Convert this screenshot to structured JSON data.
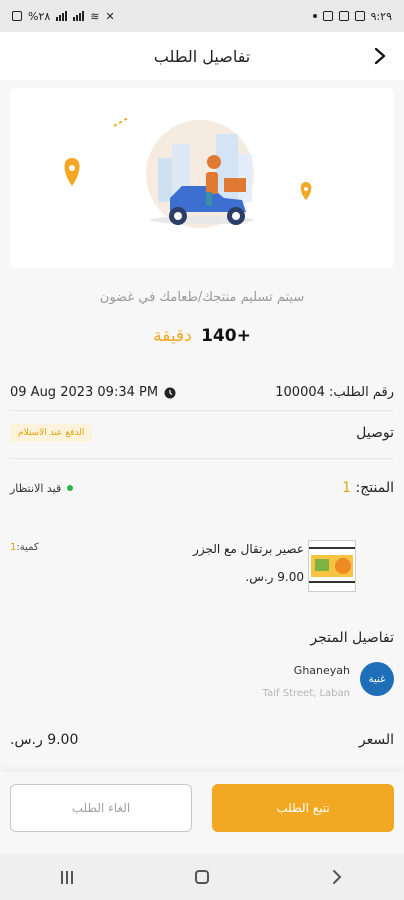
{
  "status_bar": {
    "time": "٩:٢٩",
    "battery": "%٢٨"
  },
  "header": {
    "title": "تفاصيل الطلب"
  },
  "delivery": {
    "message": "سيتم تسليم منتجك/طعامك  في غضون",
    "eta_value": "+140",
    "eta_unit": "دقيقة"
  },
  "order": {
    "number_label": "رقم الطلب:",
    "number_value": "100004",
    "datetime": "09 Aug 2023  09:34 PM",
    "type_label": "توصيل",
    "payment_badge": "الدفع عند الاستلام",
    "products_label": "المنتج:",
    "products_count": "1",
    "status": "قيد الانتظار"
  },
  "product": {
    "name": "عصير برتقال مع الجزر",
    "price": "9.00 ر.س.",
    "qty_label": "كمية:",
    "qty_value": "1"
  },
  "store": {
    "section_title": "تفاصيل المتجر",
    "logo_text": "غنية",
    "name": "Ghaneyah",
    "address": "Taif Street, Laban"
  },
  "pricing": {
    "label": "السعر",
    "value": "9.00 ر.س."
  },
  "buttons": {
    "track": "تتبع الطلب",
    "cancel": "الغاء الطلب"
  },
  "colors": {
    "accent": "#f2a823",
    "status_green": "#2bb24c",
    "brand_blue": "#1e6fb8"
  }
}
